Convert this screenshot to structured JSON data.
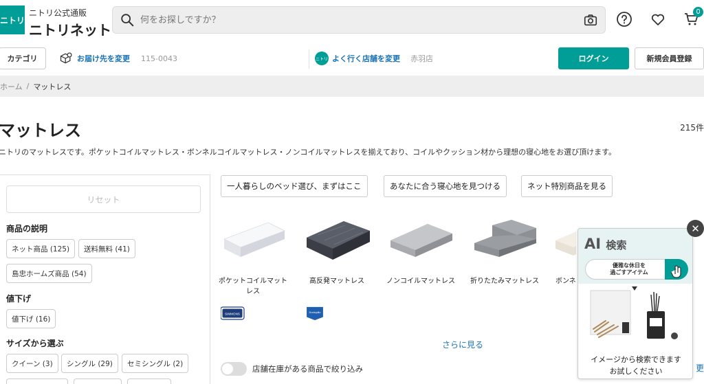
{
  "header": {
    "logo_mark": "ニトリ",
    "logo_sub": "ニトリ公式通販",
    "logo_main": "ニトリネット",
    "search_placeholder": "何をお探しですか？",
    "cart_count": "0"
  },
  "subbar": {
    "category": "カテゴリ",
    "delivery_label": "お届け先を変更",
    "postal_code": "115-0043",
    "store_logo": "ニトリ",
    "store_label": "よく行く店舗を変更",
    "store_name": "赤羽店",
    "login": "ログイン",
    "register": "新規会員登録"
  },
  "breadcrumb": {
    "home": "ホーム",
    "separator": "/",
    "current": "マットレス"
  },
  "page": {
    "title": "マットレス",
    "count": "215件",
    "description": "ニトリのマットレスです。ポケットコイルマットレス・ボンネルコイルマットレス・ノンコイルマットレスを揃えており、コイルやクッション材から理想の寝心地をお選び頂けます。"
  },
  "sidebar": {
    "reset": "リセット",
    "sections": [
      {
        "title": "商品の説明",
        "chips": [
          "ネット商品 (125)",
          "送料無料 (41)",
          "島忠ホームズ商品 (54)"
        ]
      },
      {
        "title": "値下げ",
        "chips": [
          "値下げ (16)"
        ]
      },
      {
        "title": "サイズから選ぶ",
        "chips": [
          "クイーン (3)",
          "シングル (29)",
          "セミシングル (2)"
        ]
      }
    ]
  },
  "main": {
    "tags": [
      "一人暮らしのベッド選び、まずはここ",
      "あなたに合う寝心地を見つける",
      "ネット特別商品を見る"
    ],
    "products": [
      {
        "label": "ポケットコイルマットレス"
      },
      {
        "label": "高反発マットレス"
      },
      {
        "label": "ノンコイルマットレス"
      },
      {
        "label": "折りたたみマットレス"
      },
      {
        "label": "ボンネル"
      }
    ],
    "brands": [
      "SIMMONS",
      "Dunlopillo"
    ],
    "more": "さらに見る",
    "stock_filter": "店舗在庫がある商品で絞り込み",
    "more_edge": "更"
  },
  "ai_widget": {
    "title_ai": "AI",
    "title_sub": "検索",
    "pill_line1": "優雅な休日を",
    "pill_line2": "過ごすアイテム",
    "footer_line1": "イメージから検索できます",
    "footer_line2": "お試しください",
    "close": "✕"
  },
  "colors": {
    "brand": "#009e96",
    "link": "#1a73b5"
  }
}
